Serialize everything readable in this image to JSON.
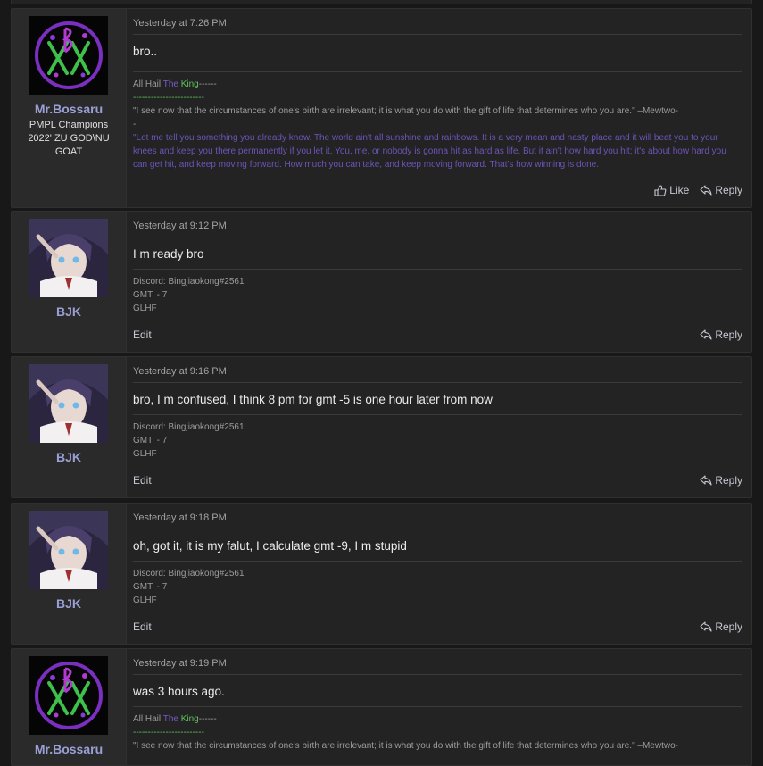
{
  "posts": [
    {
      "username": "Mr.Bossaru",
      "user_title": "PMPL Champions 2022' ZU GOD\\NU GOAT",
      "date": "Yesterday at 7:26 PM",
      "message": "bro..",
      "sig": {
        "all_hail": "All Hail ",
        "the": "The",
        "king": " King",
        "dashes1": "------",
        "dashes2": "------------------------",
        "quote1": "\"I see now that the circumstances of one's birth are irrelevant; it is what you do with the gift of life that determines who you are.\" –Mewtwo-",
        "quote1_tail": "-",
        "quote2": "\"Let me tell you something you already know. The world ain't all sunshine and rainbows. It is a very mean and nasty place and it will beat you to your knees and keep you there permanently if you let it. You, me, or nobody is gonna hit as hard as life. But it ain't how hard you hit; it's about how hard you can get hit, and keep moving forward. How much you can take, and keep moving forward. That's how winning is done."
      },
      "like_label": "Like",
      "reply_label": "Reply"
    },
    {
      "username": "BJK",
      "date": "Yesterday at 9:12 PM",
      "message": "I m ready bro",
      "sig_lines": [
        "Discord: Bingjiaokong#2561",
        "GMT: - 7",
        "GLHF"
      ],
      "edit_label": "Edit",
      "reply_label": "Reply"
    },
    {
      "username": "BJK",
      "date": "Yesterday at 9:16 PM",
      "message": "bro, I m confused, I think 8 pm for gmt -5 is one hour later from now",
      "sig_lines": [
        "Discord: Bingjiaokong#2561",
        "GMT: - 7",
        "GLHF"
      ],
      "edit_label": "Edit",
      "reply_label": "Reply"
    },
    {
      "username": "BJK",
      "date": "Yesterday at 9:18 PM",
      "message": "oh, got it, it is my falut, I calculate gmt -9, I m stupid",
      "sig_lines": [
        "Discord: Bingjiaokong#2561",
        "GMT: - 7",
        "GLHF"
      ],
      "edit_label": "Edit",
      "reply_label": "Reply"
    },
    {
      "username": "Mr.Bossaru",
      "date": "Yesterday at 9:19 PM",
      "message": "was 3 hours ago.",
      "sig": {
        "all_hail": "All Hail ",
        "the": "The",
        "king": " King",
        "dashes1": "------",
        "dashes2": "------------------------",
        "quote1": "\"I see now that the circumstances of one's birth are irrelevant; it is what you do with the gift of life that determines who you are.\" –Mewtwo-"
      }
    }
  ],
  "icons": {
    "like": "thumbs-up-icon",
    "reply": "reply-arrow-icon"
  },
  "colors": {
    "username": "#9aa0d6",
    "sig_green": "#5fc25f",
    "sig_purple": "#7a5ac8"
  }
}
